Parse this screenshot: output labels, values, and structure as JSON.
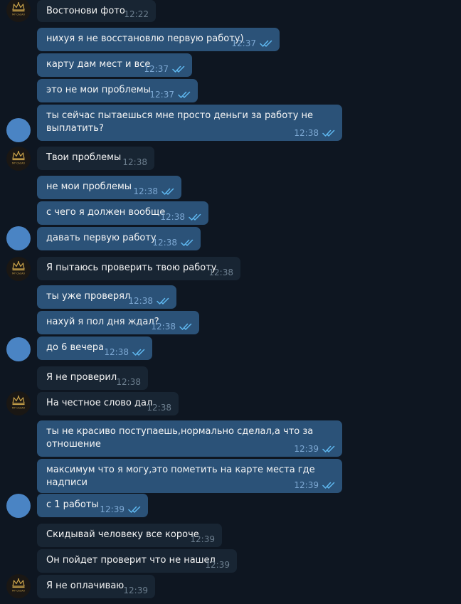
{
  "colors": {
    "background": "#0e1621",
    "outgoing_bubble": "#2b5278",
    "incoming_bubble": "#182533",
    "outgoing_time": "#7da8d3",
    "incoming_time": "#6d7f8f",
    "read_ticks": "#5fb8f0",
    "user_avatar": "#4a84c4",
    "logo_gold": "#c9a24a"
  },
  "messages": [
    {
      "dir": "in",
      "text": "Востонови фото",
      "time": "12:22"
    },
    {
      "dir": "out",
      "text": "нихуя я не восстановлю первую работу)",
      "time": "12:37",
      "read": true
    },
    {
      "dir": "out",
      "text": "карту дам мест и все",
      "time": "12:37",
      "read": true
    },
    {
      "dir": "out",
      "text": "это не мои проблемы",
      "time": "12:37",
      "read": true
    },
    {
      "dir": "out",
      "text": "ты сейчас пытаешься мне просто деньги за работу не\nвыплатить?",
      "time": "12:38",
      "read": true
    },
    {
      "dir": "in",
      "text": "Твои проблемы",
      "time": "12:38"
    },
    {
      "dir": "out",
      "text": "не мои проблемы",
      "time": "12:38",
      "read": true
    },
    {
      "dir": "out",
      "text": "с чего я должен вообще",
      "time": "12:38",
      "read": true
    },
    {
      "dir": "out",
      "text": "давать первую работу",
      "time": "12:38",
      "read": true
    },
    {
      "dir": "in",
      "text": "Я пытаюсь проверить твою работу",
      "time": "12:38"
    },
    {
      "dir": "out",
      "text": "ты уже проверял",
      "time": "12:38",
      "read": true
    },
    {
      "dir": "out",
      "text": "нахуй я пол дня ждал?",
      "time": "12:38",
      "read": true
    },
    {
      "dir": "out",
      "text": "до 6 вечера",
      "time": "12:38",
      "read": true
    },
    {
      "dir": "in",
      "text": "Я не проверил",
      "time": "12:38"
    },
    {
      "dir": "in",
      "text": "На честное слово дал",
      "time": "12:38"
    },
    {
      "dir": "out",
      "text": "ты не красиво поступаешь,нормально сделал,а что за\nотношение",
      "time": "12:39",
      "read": true
    },
    {
      "dir": "out",
      "text": "максимум что я могу,это пометить на карте места где надписи",
      "time": "12:39",
      "read": true
    },
    {
      "dir": "out",
      "text": "с 1 работы",
      "time": "12:39",
      "read": true
    },
    {
      "dir": "in",
      "text": "Скидывай человеку все короче",
      "time": "12:39"
    },
    {
      "dir": "in",
      "text": "Он пойдет проверит что не нашел",
      "time": "12:39"
    },
    {
      "dir": "in",
      "text": "Я не оплачиваю",
      "time": "12:39"
    }
  ],
  "avatars": [
    {
      "kind": "logo",
      "icon": "crown-logo-icon",
      "logo_text": "MY CACAO"
    },
    {
      "kind": "user",
      "icon": "user-avatar-icon"
    },
    {
      "kind": "logo",
      "icon": "crown-logo-icon",
      "logo_text": "MY CACAO"
    },
    {
      "kind": "user",
      "icon": "user-avatar-icon"
    },
    {
      "kind": "logo",
      "icon": "crown-logo-icon",
      "logo_text": "MY CACAO"
    },
    {
      "kind": "user",
      "icon": "user-avatar-icon"
    },
    {
      "kind": "logo",
      "icon": "crown-logo-icon",
      "logo_text": "MY CACAO"
    },
    {
      "kind": "user",
      "icon": "user-avatar-icon"
    },
    {
      "kind": "logo",
      "icon": "crown-logo-icon",
      "logo_text": "MY CACAO"
    }
  ]
}
